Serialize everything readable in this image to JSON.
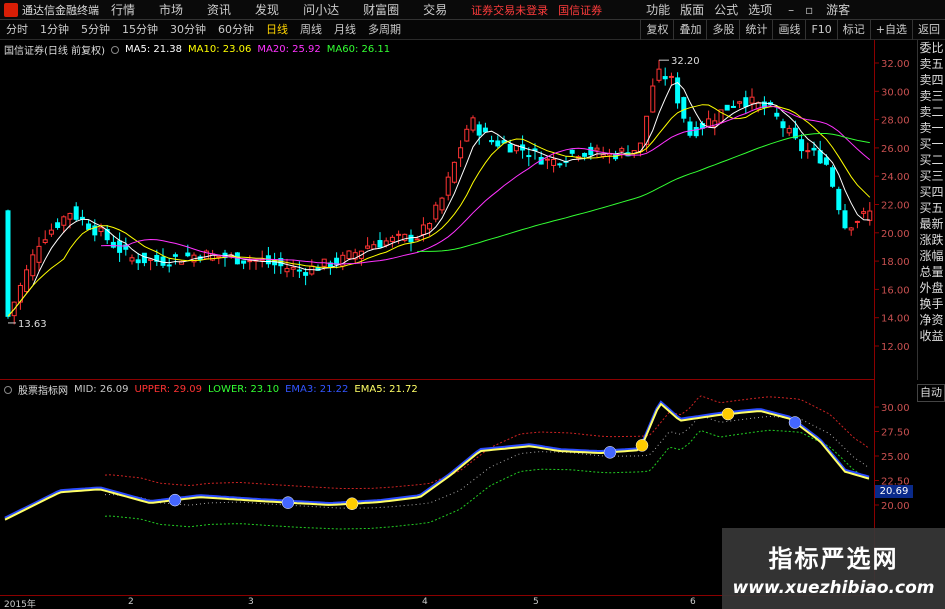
{
  "app": {
    "title": "通达信金融终端",
    "menus": [
      "行情",
      "市场",
      "资讯",
      "发现",
      "问小达",
      "财富圈",
      "交易"
    ],
    "notice_login": "证券交易未登录",
    "notice_broker": "国信证券",
    "right_menus": [
      "功能",
      "版面",
      "公式",
      "选项",
      "游客"
    ]
  },
  "toolbar": {
    "periods": [
      "分时",
      "1分钟",
      "5分钟",
      "15分钟",
      "30分钟",
      "60分钟",
      "日线",
      "周线",
      "月线",
      "多周期"
    ],
    "active_period": "日线",
    "right_buttons": [
      "复权",
      "叠加",
      "多股",
      "统计",
      "画线",
      "F10",
      "标记",
      "+自选",
      "返回"
    ]
  },
  "main_chart": {
    "stock_label": "国信证券(日线 前复权)",
    "ma_legend": [
      {
        "label": "MA5: 21.38",
        "color": "#ffffff"
      },
      {
        "label": "MA10: 23.06",
        "color": "#ffff00"
      },
      {
        "label": "MA20: 25.92",
        "color": "#ff00ff"
      },
      {
        "label": "MA60: 26.11",
        "color": "#00ff00"
      }
    ],
    "y_ticks": [
      "32.00",
      "30.00",
      "28.00",
      "26.00",
      "24.00",
      "22.00",
      "20.00",
      "18.00",
      "16.00",
      "14.00",
      "12.00"
    ],
    "high_label": "32.20",
    "low_label": "13.63"
  },
  "indicator_chart": {
    "name": "股票指标网",
    "legend": [
      {
        "label": "MID: 26.09",
        "color": "#c8c8c8"
      },
      {
        "label": "UPPER: 29.09",
        "color": "#ff3333"
      },
      {
        "label": "LOWER: 23.10",
        "color": "#33ff33"
      },
      {
        "label": "EMA3: 21.22",
        "color": "#3355ff"
      },
      {
        "label": "EMA5: 21.72",
        "color": "#ffff66"
      }
    ],
    "y_ticks": [
      "30.00",
      "27.50",
      "25.00",
      "22.50",
      "20.00"
    ],
    "price_tag": "20.69",
    "auto_label": "自动"
  },
  "side_panel": [
    "委比",
    "卖五",
    "卖四",
    "卖三",
    "卖二",
    "卖一",
    "买一",
    "买二",
    "买三",
    "买四",
    "买五",
    "最新",
    "涨跌",
    "涨幅",
    "总量",
    "外盘",
    "换手",
    "净资",
    "收益"
  ],
  "x_axis": [
    "2015年",
    "2",
    "3",
    "4",
    "5",
    "6"
  ],
  "watermark": {
    "cn": "指标严选网",
    "url": "www.xuezhibiao.com"
  },
  "colors": {
    "up": "#ff3333",
    "down": "#00ffff",
    "frame": "#8b0000",
    "brand": "#d81e06"
  }
}
